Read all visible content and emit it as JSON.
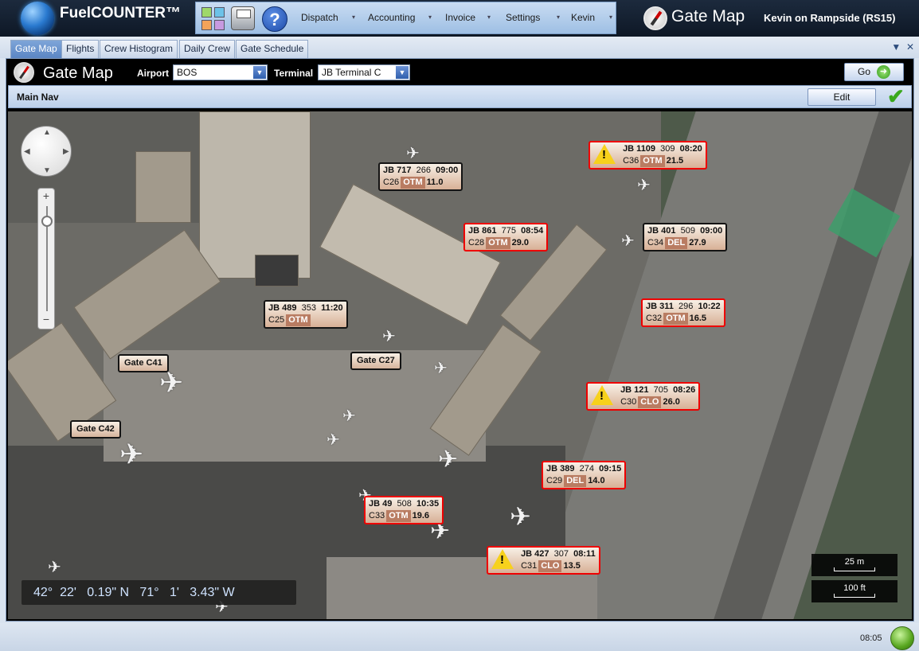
{
  "app": {
    "title": "FuelCOUNTER™"
  },
  "menu": [
    {
      "label": "Dispatch"
    },
    {
      "label": "Accounting"
    },
    {
      "label": "Invoice"
    },
    {
      "label": "Settings"
    },
    {
      "label": "Kevin"
    }
  ],
  "header_right": {
    "title": "Gate Map",
    "user": "Kevin on Rampside (RS15)"
  },
  "tabs": [
    {
      "label": "Gate Map",
      "active": true
    },
    {
      "label": "Flights"
    },
    {
      "label": "Crew Histogram"
    },
    {
      "label": "Daily Crew"
    },
    {
      "label": "Gate Schedule"
    }
  ],
  "gatemap": {
    "title": "Gate Map",
    "airport_label": "Airport",
    "airport_value": "BOS",
    "terminal_label": "Terminal",
    "terminal_value": "JB Terminal C",
    "go_label": "Go",
    "nav_title": "Main Nav",
    "edit_label": "Edit"
  },
  "flights": [
    {
      "flight": "JB 717",
      "num": "266",
      "time": "09:00",
      "gate": "C26",
      "status": "OTM",
      "fuel": "11.0",
      "alert": false,
      "warning": false
    },
    {
      "flight": "JB 1109",
      "num": "309",
      "time": "08:20",
      "gate": "C36",
      "status": "OTM",
      "fuel": "21.5",
      "alert": true,
      "warning": true
    },
    {
      "flight": "JB 861",
      "num": "775",
      "time": "08:54",
      "gate": "C28",
      "status": "OTM",
      "fuel": "29.0",
      "alert": true,
      "warning": false
    },
    {
      "flight": "JB 401",
      "num": "509",
      "time": "09:00",
      "gate": "C34",
      "status": "DEL",
      "fuel": "27.9",
      "alert": false,
      "warning": false
    },
    {
      "flight": "JB 489",
      "num": "353",
      "time": "11:20",
      "gate": "C25",
      "status": "OTM",
      "fuel": "",
      "alert": false,
      "warning": false
    },
    {
      "flight": "JB 311",
      "num": "296",
      "time": "10:22",
      "gate": "C32",
      "status": "OTM",
      "fuel": "16.5",
      "alert": true,
      "warning": false
    },
    {
      "flight": "JB 121",
      "num": "705",
      "time": "08:26",
      "gate": "C30",
      "status": "CLO",
      "fuel": "26.0",
      "alert": true,
      "warning": true
    },
    {
      "flight": "JB 389",
      "num": "274",
      "time": "09:15",
      "gate": "C29",
      "status": "DEL",
      "fuel": "14.0",
      "alert": true,
      "warning": false
    },
    {
      "flight": "JB 49",
      "num": "508",
      "time": "10:35",
      "gate": "C33",
      "status": "OTM",
      "fuel": "19.6",
      "alert": true,
      "warning": false
    },
    {
      "flight": "JB 427",
      "num": "307",
      "time": "08:11",
      "gate": "C31",
      "status": "CLO",
      "fuel": "13.5",
      "alert": true,
      "warning": true
    }
  ],
  "gates": [
    {
      "label": "Gate C41"
    },
    {
      "label": "Gate C27"
    },
    {
      "label": "Gate C42"
    }
  ],
  "map": {
    "coords": "42°  22'   0.19\" N   71°   1'   3.43\" W",
    "scale_m": "25 m",
    "scale_ft": "100 ft"
  },
  "status": {
    "time": "08:05"
  },
  "colors": {
    "alert_border": "#e00000",
    "status_chip": "#b97c62",
    "brand_dark": "#0e1826"
  },
  "icons": [
    "globe-icon",
    "apps-icon",
    "print-icon",
    "help-icon",
    "compass-icon",
    "go-arrow-icon",
    "check-icon",
    "warning-icon",
    "pan-control-icon",
    "status-led-icon"
  ]
}
